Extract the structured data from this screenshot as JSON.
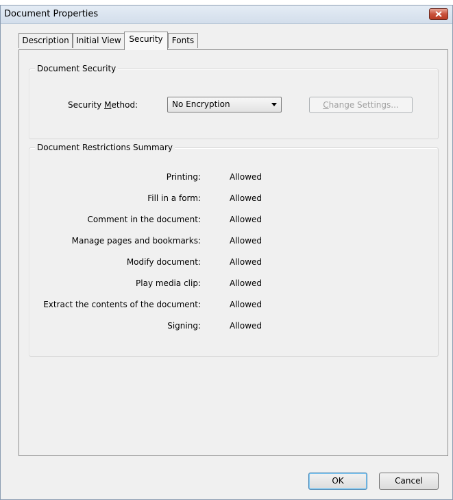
{
  "window": {
    "title": "Document Properties"
  },
  "tabs": [
    {
      "label": "Description"
    },
    {
      "label": "Initial View"
    },
    {
      "label": "Security"
    },
    {
      "label": "Fonts"
    }
  ],
  "active_tab": "Security",
  "document_security": {
    "legend": "Document Security",
    "method_label_pre": "Security ",
    "method_label_mnemonic": "M",
    "method_label_post": "ethod:",
    "method_value": "No Encryption",
    "change_settings_mnemonic": "C",
    "change_settings_rest": "hange Settings..."
  },
  "restrictions": {
    "legend": "Document Restrictions Summary",
    "rows": [
      {
        "label": "Printing:",
        "value": "Allowed"
      },
      {
        "label": "Fill in a form:",
        "value": "Allowed"
      },
      {
        "label": "Comment in the document:",
        "value": "Allowed"
      },
      {
        "label": "Manage pages and bookmarks:",
        "value": "Allowed"
      },
      {
        "label": "Modify document:",
        "value": "Allowed"
      },
      {
        "label": "Play media clip:",
        "value": "Allowed"
      },
      {
        "label": "Extract the contents of the document:",
        "value": "Allowed"
      },
      {
        "label": "Signing:",
        "value": "Allowed"
      }
    ]
  },
  "buttons": {
    "ok": "OK",
    "cancel": "Cancel"
  },
  "colors": {
    "close_button": "#c9523c",
    "window_border": "#8a9bb0"
  }
}
